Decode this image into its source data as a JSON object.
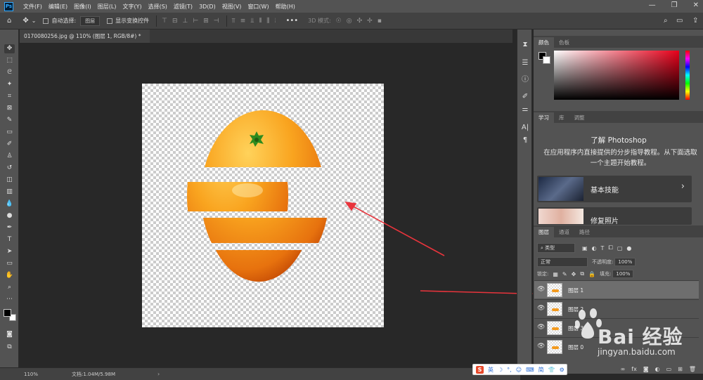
{
  "app": {
    "logo": "Ps",
    "menu": [
      "文件(F)",
      "编辑(E)",
      "图像(I)",
      "图层(L)",
      "文字(Y)",
      "选择(S)",
      "滤镜(T)",
      "3D(D)",
      "视图(V)",
      "窗口(W)",
      "帮助(H)"
    ]
  },
  "options_bar": {
    "auto_select_label": "自动选择:",
    "auto_select_value": "图层",
    "show_transform_label": "显示变换控件",
    "mode_3d_label": "3D 模式:"
  },
  "document": {
    "tab_title": "0170080256.jpg @ 110% (图层 1, RGB/8#) *"
  },
  "status": {
    "zoom": "110%",
    "doc_size": "文档:1.04M/5.98M"
  },
  "color_panel": {
    "tabs": [
      "颜色",
      "色板"
    ]
  },
  "learn_panel": {
    "tabs": [
      "学习",
      "库",
      "调整"
    ],
    "title": "了解 Photoshop",
    "description": "在应用程序内直接提供的分步指导教程。从下面选取一个主题开始教程。",
    "cards": [
      {
        "label": "基本技能"
      },
      {
        "label": "修复照片"
      }
    ]
  },
  "layers_panel": {
    "tabs": [
      "图层",
      "通道",
      "路径"
    ],
    "filter_value": "类型",
    "blend_mode": "正常",
    "opacity_label": "不透明度:",
    "opacity_value": "100%",
    "lock_label": "锁定:",
    "fill_label": "填充:",
    "fill_value": "100%",
    "layers": [
      {
        "name": "图层 1",
        "selected": true
      },
      {
        "name": "图层 2",
        "selected": false
      },
      {
        "name": "图层 3",
        "selected": false
      },
      {
        "name": "图层 0",
        "selected": false
      }
    ]
  },
  "watermark": {
    "text": "Bai 经验",
    "url": "jingyan.baidu.com"
  },
  "ime": {
    "items": [
      "英",
      "☽",
      "°,",
      "☺",
      "⌨",
      "简",
      "👕",
      "⚙"
    ]
  },
  "annotation_color": "#e8343c",
  "fruit_color": "#f39a1e"
}
